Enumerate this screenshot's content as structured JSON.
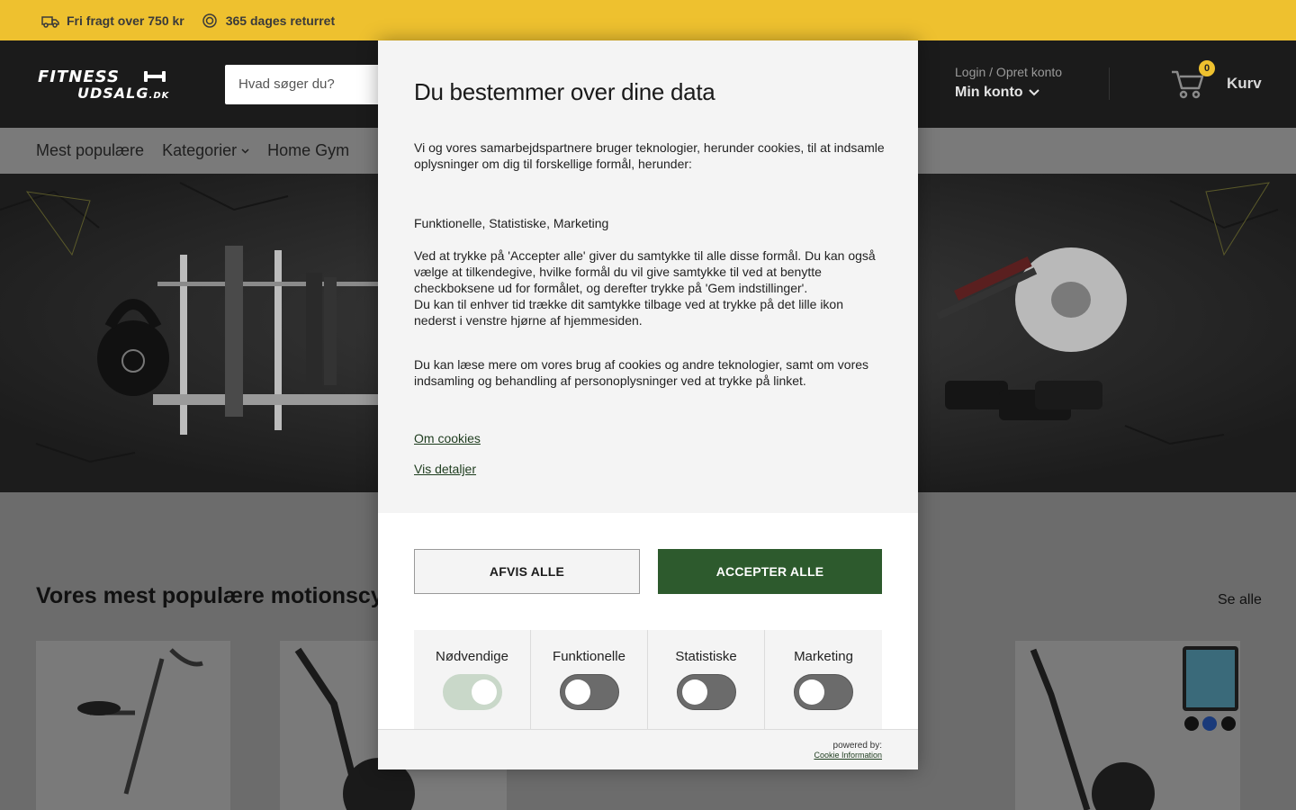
{
  "topbar": {
    "items": [
      {
        "icon": "truck-icon",
        "label": "Fri fragt over 750 kr"
      },
      {
        "icon": "return-icon",
        "label": "365 dages returret"
      }
    ]
  },
  "header": {
    "logo_line1": "FITNESS",
    "logo_line2": "UDSALG",
    "logo_suffix": ".DK",
    "search_placeholder": "Hvad søger du?",
    "account_login": "Login / Opret konto",
    "account_main": "Min konto",
    "cart_count": "0",
    "cart_label": "Kurv"
  },
  "nav": {
    "items": [
      {
        "label": "Mest populære"
      },
      {
        "label": "Kategorier"
      },
      {
        "label": "Home Gym"
      }
    ]
  },
  "section": {
    "title": "Vores mest populære motionscyk",
    "see_all": "Se alle"
  },
  "modal": {
    "title": "Du bestemmer over dine data",
    "intro": "Vi og vores samarbejdspartnere bruger teknologier, herunder cookies, til at indsamle oplysninger om dig til forskellige formål, herunder:",
    "purposes": "Funktionelle, Statistiske, Marketing",
    "consent_text_1": "Ved at trykke på 'Accepter alle' giver du samtykke til alle disse formål. Du kan også vælge at tilkendegive, hvilke formål du vil give samtykke til ved at benytte checkboksene ud for formålet, og derefter trykke på 'Gem indstillinger'.",
    "consent_text_2": "Du kan til enhver tid trække dit samtykke tilbage ved at trykke på det lille ikon nederst i venstre hjørne af hjemmesiden.",
    "read_more": "Du kan læse mere om vores brug af cookies og andre teknologier, samt om vores indsamling og behandling af personoplysninger ved at trykke på linket.",
    "link_cookies": "Om cookies",
    "link_details": "Vis detaljer",
    "btn_reject": "AFVIS ALLE",
    "btn_accept": "ACCEPTER ALLE",
    "toggles": [
      {
        "label": "Nødvendige",
        "on": true
      },
      {
        "label": "Funktionelle",
        "on": false
      },
      {
        "label": "Statistiske",
        "on": false
      },
      {
        "label": "Marketing",
        "on": false
      }
    ],
    "powered_by": "powered by:",
    "powered_brand": "Cookie Information"
  },
  "colors": {
    "topbar": "#eec12f",
    "header": "#1b1b1b",
    "accept": "#2d5a2d",
    "toggle_on": "#c9d8c9",
    "toggle_off": "#6b6b6b"
  }
}
